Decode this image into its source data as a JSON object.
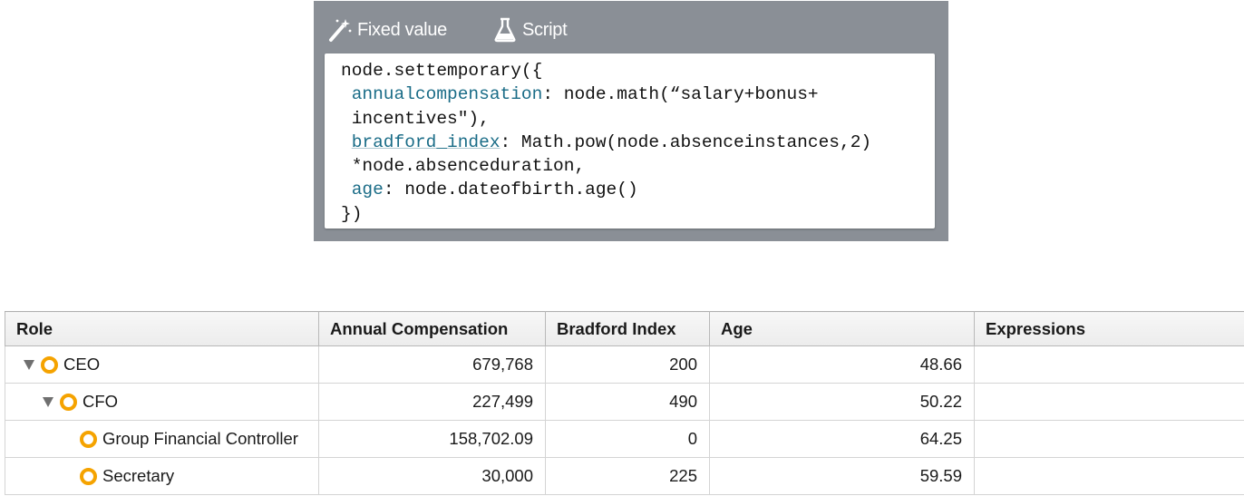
{
  "editor": {
    "tabs": [
      {
        "label": "Fixed value",
        "icon": "magic-wand-icon"
      },
      {
        "label": "Script",
        "icon": "flask-icon"
      }
    ],
    "code": {
      "line1": "node.settemporary({",
      "line2_key": "annualcompensation",
      "line2_rest": ": node.math(“salary+bonus+",
      "line3": " incentives\"),",
      "line4_key": "bradford_index",
      "line4_rest": ": Math.pow(node.absenceinstances,2)",
      "line5": " *node.absenceduration,",
      "line6_key": "age",
      "line6_rest": ": node.dateofbirth.age()",
      "line7": "})"
    }
  },
  "table": {
    "columns": [
      "Role",
      "Annual Compensation",
      "Bradford Index",
      "Age",
      "Expressions"
    ],
    "rows": [
      {
        "role": "CEO",
        "annual_compensation": "679,768",
        "bradford_index": "200",
        "age": "48.66",
        "expressions": ""
      },
      {
        "role": "CFO",
        "annual_compensation": "227,499",
        "bradford_index": "490",
        "age": "50.22",
        "expressions": ""
      },
      {
        "role": "Group Financial Controller",
        "annual_compensation": "158,702.09",
        "bradford_index": "0",
        "age": "64.25",
        "expressions": ""
      },
      {
        "role": "Secretary",
        "annual_compensation": "30,000",
        "bradford_index": "225",
        "age": "59.59",
        "expressions": ""
      }
    ]
  },
  "colors": {
    "panel_bg": "#8a8f96",
    "keyword": "#1a6c87",
    "node_dot": "#f5a300"
  }
}
